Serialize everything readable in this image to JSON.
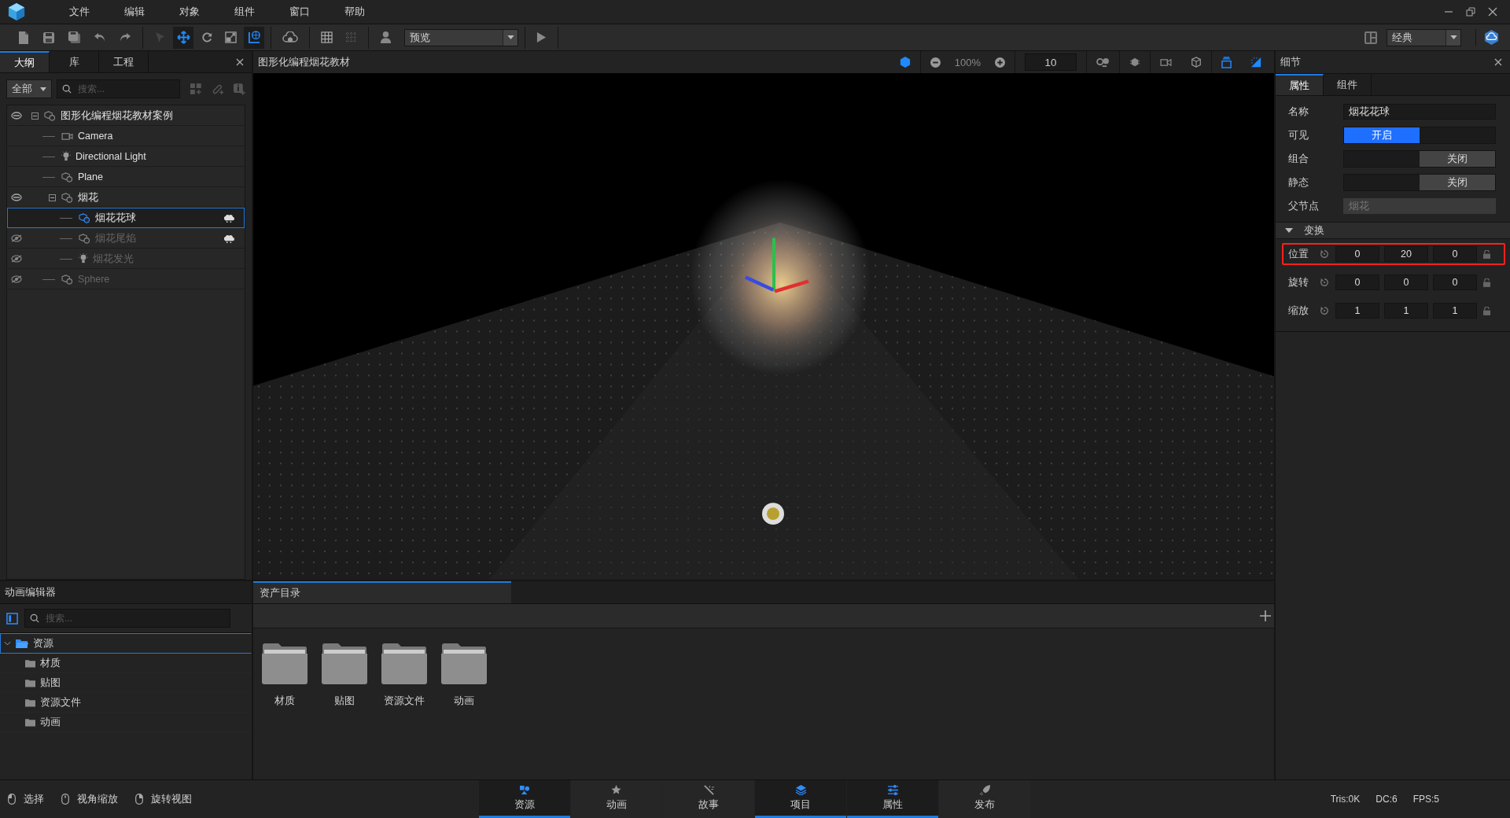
{
  "menu": [
    "文件",
    "编辑",
    "对象",
    "组件",
    "窗口",
    "帮助"
  ],
  "toolbar": {
    "tools": [
      {
        "selected": false,
        "disabled": true
      },
      {
        "selected": true,
        "disabled": false
      },
      {
        "selected": false,
        "disabled": false
      },
      {
        "selected": false,
        "disabled": false
      },
      {
        "selected": true,
        "disabled": false
      }
    ],
    "preview": "预览",
    "layout": "经典"
  },
  "outline": {
    "tabs": [
      {
        "label": "大纲",
        "selected": true
      },
      {
        "label": "库",
        "selected": false
      },
      {
        "label": "工程",
        "selected": false
      }
    ],
    "filter": "全部",
    "search": {
      "placeholder": "搜索..."
    },
    "tree": [
      {
        "name": "图形化编程烟花教材案例",
        "kind": "mesh",
        "hidden": false,
        "selected": false,
        "particles": false,
        "expanded": true,
        "children": [
          {
            "name": "Camera",
            "kind": "camera",
            "hidden": false,
            "selected": false,
            "particles": false
          },
          {
            "name": "Directional Light",
            "kind": "light",
            "hidden": false,
            "selected": false,
            "particles": false
          },
          {
            "name": "Plane",
            "kind": "mesh",
            "hidden": false,
            "selected": false,
            "particles": false
          },
          {
            "name": "烟花",
            "kind": "mesh",
            "hidden": false,
            "selected": false,
            "particles": false,
            "expanded": true,
            "children": [
              {
                "name": "烟花花球",
                "kind": "mesh",
                "hidden": false,
                "selected": true,
                "particles": true
              },
              {
                "name": "烟花尾焰",
                "kind": "mesh",
                "hidden": true,
                "selected": false,
                "particles": true
              },
              {
                "name": "烟花发光",
                "kind": "light",
                "hidden": true,
                "selected": false,
                "particles": false
              }
            ]
          },
          {
            "name": "Sphere",
            "kind": "mesh",
            "hidden": true,
            "selected": false,
            "particles": false
          }
        ]
      }
    ]
  },
  "viewport": {
    "title": "图形化编程烟花教材",
    "zoom": "100%",
    "grid_size": "10",
    "toggles": [
      {
        "on": true
      },
      {
        "on": false
      },
      {
        "on": false
      },
      {
        "on": false
      },
      {
        "on": true
      },
      {
        "on": true
      }
    ]
  },
  "details": {
    "title": "细节",
    "tabs": [
      {
        "label": "属性",
        "selected": true
      },
      {
        "label": "组件",
        "selected": false
      }
    ],
    "properties": [
      {
        "kind": "text",
        "label": "名称",
        "value": "烟花花球"
      },
      {
        "kind": "toggle",
        "label": "可见",
        "on": true,
        "text": "开启"
      },
      {
        "kind": "toggle",
        "label": "组合",
        "on": false,
        "text": "关闭"
      },
      {
        "kind": "toggle",
        "label": "静态",
        "on": false,
        "text": "关闭"
      },
      {
        "kind": "readonly",
        "label": "父节点",
        "value": "烟花"
      }
    ],
    "transform": {
      "title": "变换",
      "expanded": true,
      "rows": [
        {
          "label": "位置",
          "values": [
            "0",
            "20",
            "0"
          ],
          "highlighted": true
        },
        {
          "label": "旋转",
          "values": [
            "0",
            "0",
            "0"
          ],
          "highlighted": false
        },
        {
          "label": "缩放",
          "values": [
            "1",
            "1",
            "1"
          ],
          "highlighted": false
        }
      ]
    }
  },
  "animation_editor": {
    "title": "动画编辑器",
    "search": {
      "placeholder": "搜索..."
    },
    "tree": [
      {
        "name": "资源",
        "selected": true,
        "expanded": true,
        "children": [
          {
            "name": "材质"
          },
          {
            "name": "贴图"
          },
          {
            "name": "资源文件"
          },
          {
            "name": "动画"
          }
        ]
      }
    ]
  },
  "assets": {
    "tab": {
      "label": "资产目录",
      "selected": true
    },
    "folders": [
      "材质",
      "贴图",
      "资源文件",
      "动画"
    ]
  },
  "status_bar": {
    "hints": [
      "选择",
      "视角缩放",
      "旋转视图"
    ],
    "tabs": [
      {
        "label": "资源",
        "selected": true
      },
      {
        "label": "动画",
        "selected": false
      },
      {
        "label": "故事",
        "selected": false
      },
      {
        "label": "项目",
        "selected": true
      },
      {
        "label": "属性",
        "selected": true
      },
      {
        "label": "发布",
        "selected": false
      }
    ],
    "stats": [
      "Tris:0K",
      "DC:6",
      "FPS:5"
    ]
  }
}
